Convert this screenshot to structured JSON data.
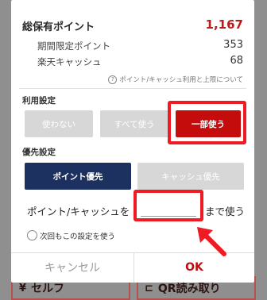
{
  "background": {
    "self_button": "セルフ",
    "self_icon": "¥",
    "qr_button": "QR読み取り",
    "qr_icon": "⊏"
  },
  "summary": {
    "total_label": "総保有ポイント",
    "total_value": "1,167",
    "limited_label": "期間限定ポイント",
    "limited_value": "353",
    "cash_label": "楽天キャッシュ",
    "cash_value": "68",
    "help_text": "ポイント/キャッシュ利用と上限について",
    "help_icon": "question-circle-icon"
  },
  "usage": {
    "title": "利用設定",
    "options": [
      "使わない",
      "すべて使う",
      "一部使う"
    ],
    "selected": "一部使う"
  },
  "priority": {
    "title": "優先設定",
    "options": [
      "ポイント優先",
      "キャッシュ優先"
    ],
    "selected": "ポイント優先"
  },
  "amount": {
    "prefix": "ポイント/キャッシュを",
    "value": "",
    "suffix": "まで使う"
  },
  "remember": {
    "label": "次回もこの設定を使う",
    "checked": false
  },
  "footer": {
    "cancel": "キャンセル",
    "ok": "OK"
  },
  "colors": {
    "accent_red": "#c40c0c",
    "navy": "#1d3160",
    "highlight": "#ee1b24"
  }
}
